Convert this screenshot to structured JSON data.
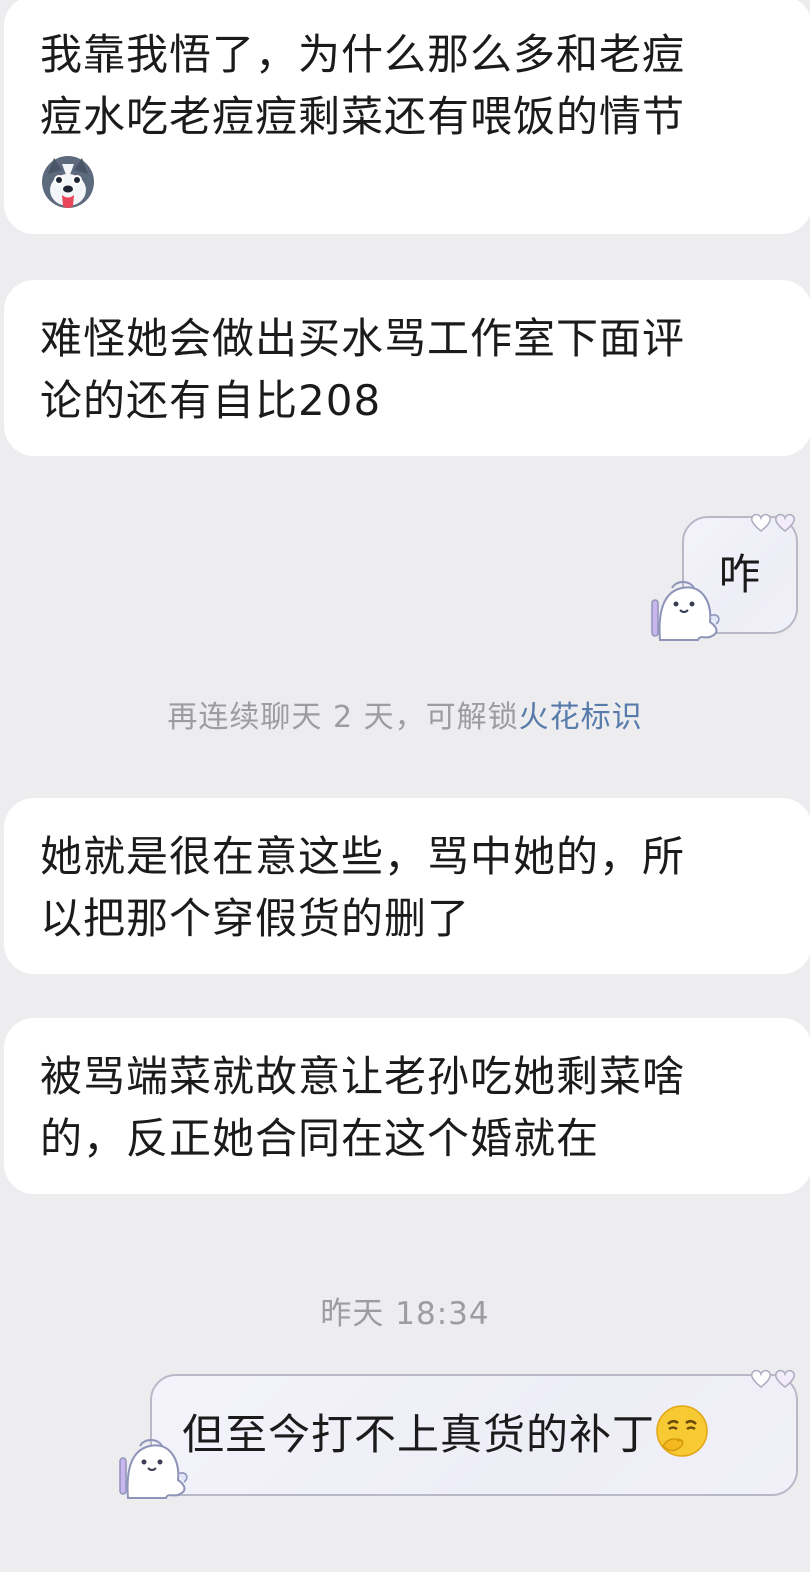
{
  "messages": [
    {
      "side": "in",
      "lines": [
        "我靠我悟了，为什么那么多和老痘",
        "痘水吃老痘痘剩菜还有喂饭的情节"
      ],
      "emoji": "husky-emoji"
    },
    {
      "side": "in",
      "lines": [
        "难怪她会做出买水骂工作室下面评",
        "论的还有自比208"
      ]
    },
    {
      "side": "out",
      "text": "咋"
    },
    {
      "side": "in",
      "lines": [
        "她就是很在意这些，骂中她的，所",
        "以把那个穿假货的删了"
      ]
    },
    {
      "side": "in",
      "lines": [
        "被骂端菜就故意让老孙吃她剩菜啥",
        "的，反正她合同在这个婚就在"
      ]
    },
    {
      "side": "out",
      "text": "但至今打不上真货的补丁",
      "emoji": "thinking-face-emoji"
    }
  ],
  "system_tip": {
    "prefix": "再连续聊天 2 天，可解锁",
    "link": "火花标识"
  },
  "timestamp": "昨天 18:34",
  "colors": {
    "background": "#ededef",
    "incoming_bubble": "#ffffff",
    "outgoing_border": "#b9b8c7",
    "tip_text": "#9c9ca2",
    "link": "#577bab"
  }
}
